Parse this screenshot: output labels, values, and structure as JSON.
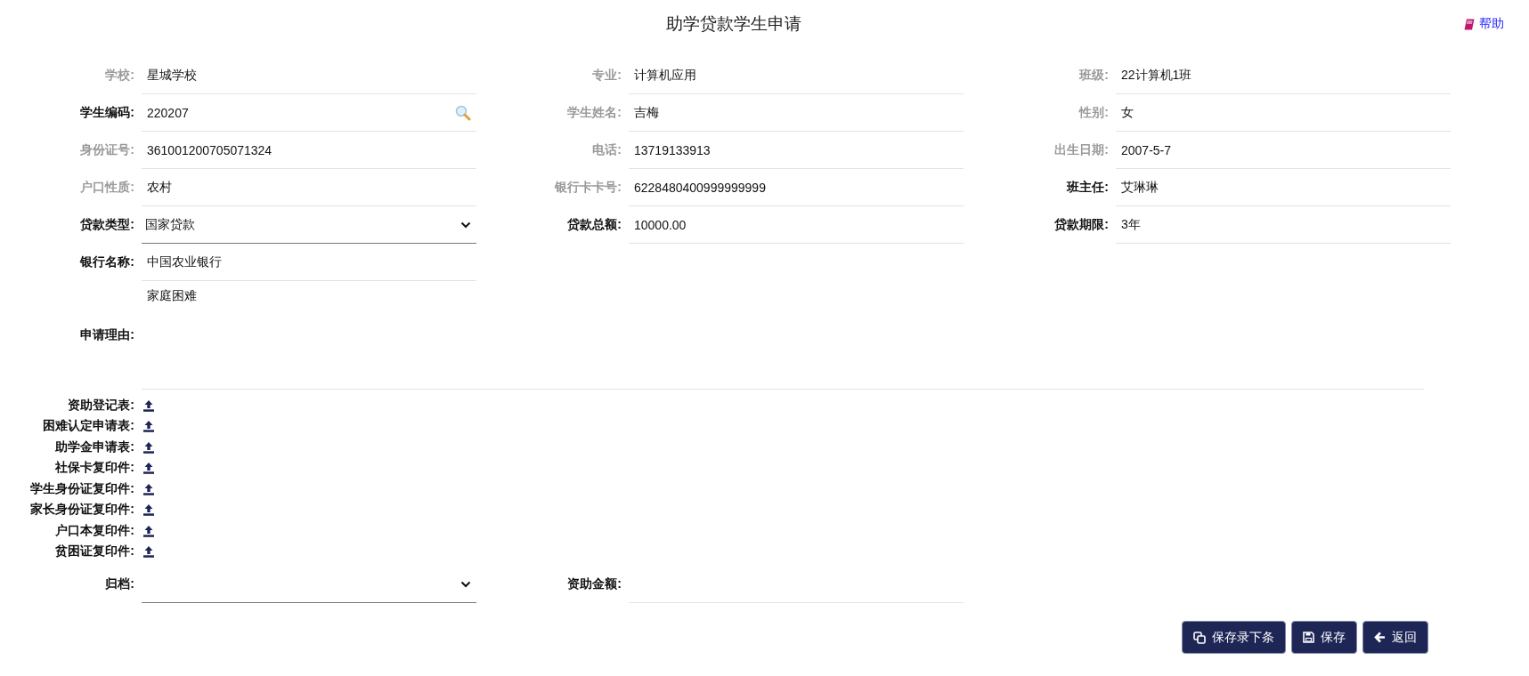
{
  "title": "助学贷款学生申请",
  "help_link": {
    "label": "帮助"
  },
  "rows": [
    [
      {
        "label": "学校:",
        "value": "星城学校",
        "kind": "text",
        "required": false
      },
      {
        "label": "专业:",
        "value": "计算机应用",
        "kind": "text",
        "required": false
      },
      {
        "label": "班级:",
        "value": "22计算机1班",
        "kind": "text",
        "required": false
      }
    ],
    [
      {
        "label": "学生编码:",
        "value": "220207",
        "kind": "search",
        "required": true
      },
      {
        "label": "学生姓名:",
        "value": "吉梅",
        "kind": "text",
        "required": false
      },
      {
        "label": "性别:",
        "value": "女",
        "kind": "text",
        "required": false
      }
    ],
    [
      {
        "label": "身份证号:",
        "value": "361001200705071324",
        "kind": "text",
        "required": false
      },
      {
        "label": "电话:",
        "value": "13719133913",
        "kind": "text",
        "required": false
      },
      {
        "label": "出生日期:",
        "value": "2007-5-7",
        "kind": "text",
        "required": false
      }
    ],
    [
      {
        "label": "户口性质:",
        "value": "农村",
        "kind": "text",
        "required": false
      },
      {
        "label": "银行卡卡号:",
        "value": "6228480400999999999",
        "kind": "text",
        "required": false
      },
      {
        "label": "班主任:",
        "value": "艾琳琳",
        "kind": "text",
        "required": true
      }
    ],
    [
      {
        "label": "贷款类型:",
        "value": "国家贷款",
        "kind": "select",
        "required": true
      },
      {
        "label": "贷款总额:",
        "value": "10000.00",
        "kind": "text",
        "required": true
      },
      {
        "label": "贷款期限:",
        "value": "3年",
        "kind": "text",
        "required": true
      }
    ],
    [
      {
        "label": "银行名称:",
        "value": "中国农业银行",
        "kind": "text",
        "required": true
      }
    ]
  ],
  "reason": {
    "label": "申请理由:",
    "value": "家庭困难"
  },
  "uploads": [
    {
      "label": "资助登记表:"
    },
    {
      "label": "困难认定申请表:"
    },
    {
      "label": "助学金申请表:"
    },
    {
      "label": "社保卡复印件:"
    },
    {
      "label": "学生身份证复印件:"
    },
    {
      "label": "家长身份证复印件:"
    },
    {
      "label": "户口本复印件:"
    },
    {
      "label": "贫困证复印件:"
    }
  ],
  "bottom_row": [
    {
      "label": "归档:",
      "kind": "select",
      "required": true
    },
    {
      "label": "资助金额:",
      "kind": "text",
      "required": true
    }
  ],
  "buttons": [
    {
      "label": "保存录下条",
      "kind": "copy"
    },
    {
      "label": "保存",
      "kind": "save"
    },
    {
      "label": "返回",
      "kind": "back"
    }
  ]
}
